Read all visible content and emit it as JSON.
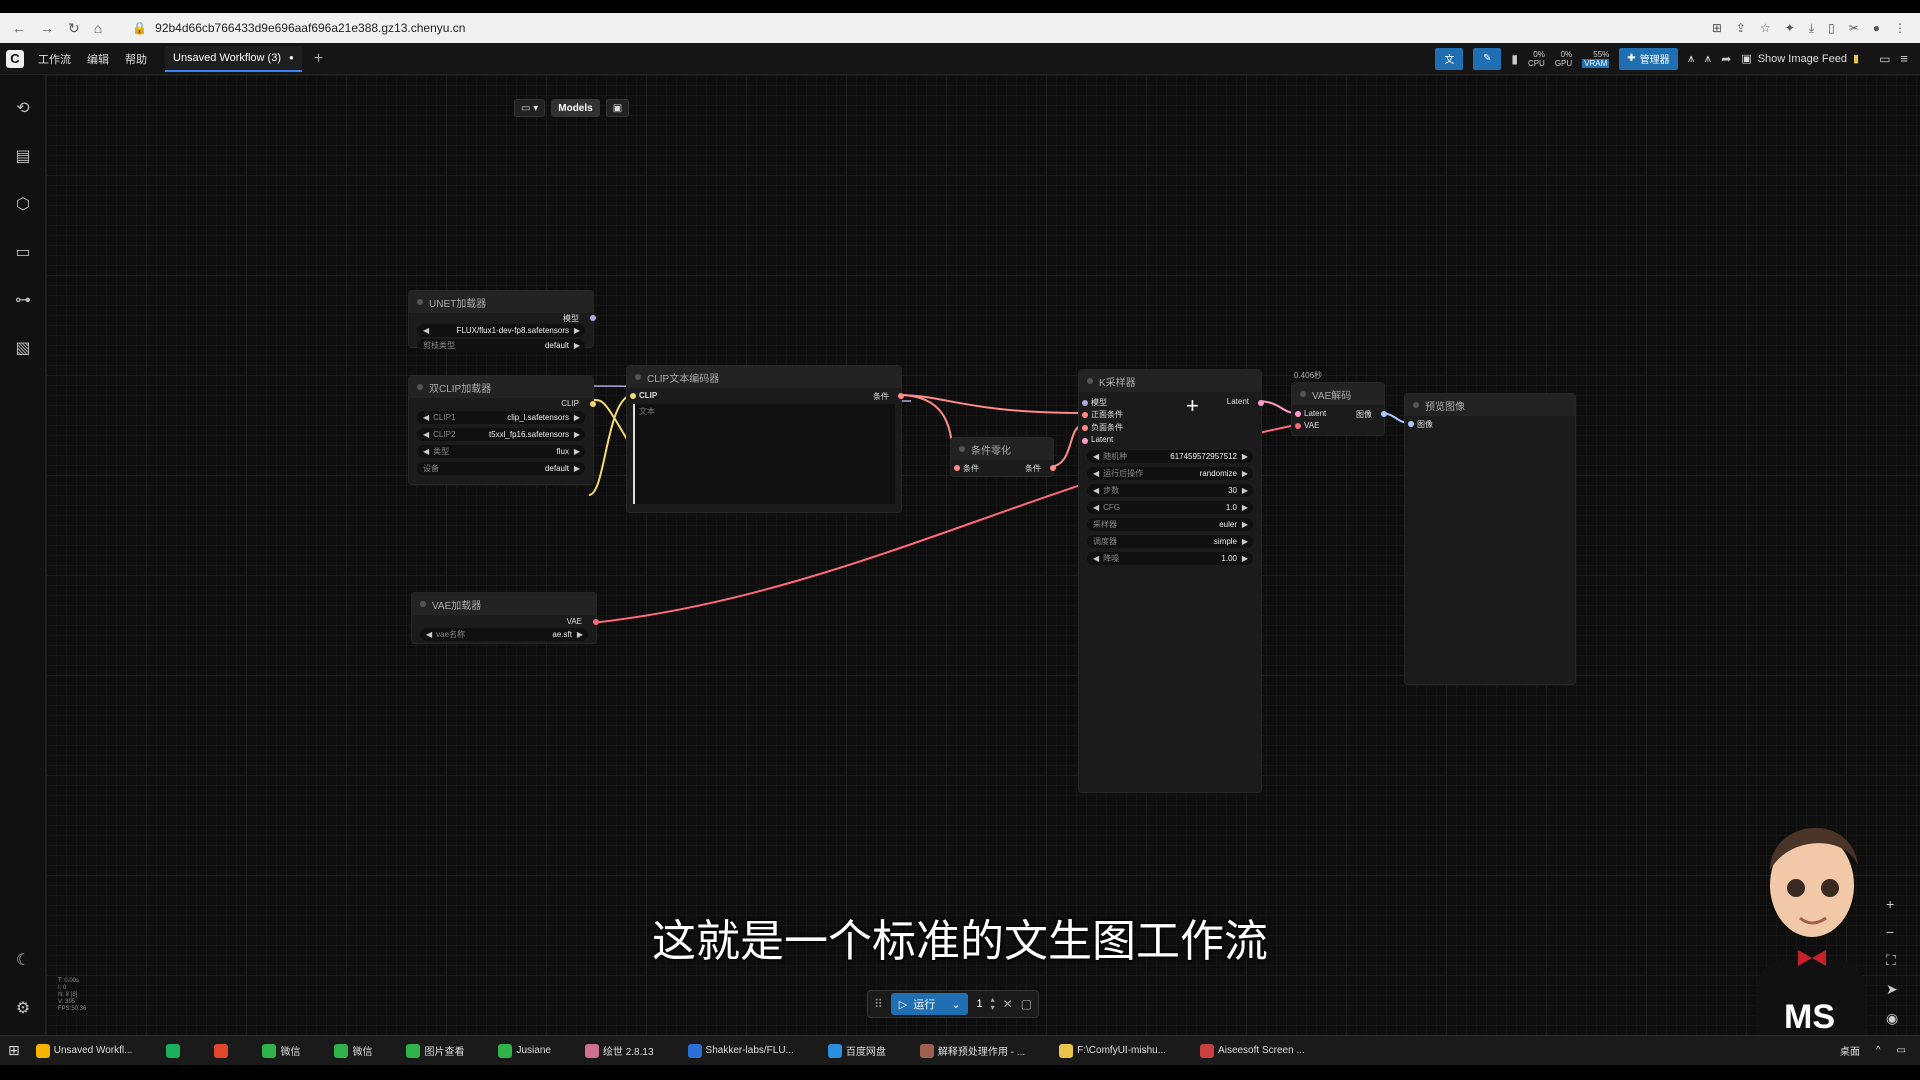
{
  "browser": {
    "url": "92b4d66cb766433d9e696aaf696a21e388.gz13.chenyu.cn"
  },
  "app": {
    "menu": [
      "工作流",
      "编辑",
      "帮助"
    ],
    "tab_label": "Unsaved Workflow (3)",
    "tab_modified_mark": "●",
    "logo_text": "C",
    "cpu_label": "CPU",
    "cpu_value": "0%",
    "gpu_label": "GPU",
    "gpu_value": "0%",
    "vram_label": "VRAM",
    "vram_value": "55%",
    "manager_label": "管理器",
    "show_image_feed_label": "Show Image Feed"
  },
  "canvas_toolbar": {
    "models_label": "Models"
  },
  "nodes": {
    "unet": {
      "title": "UNET加载器",
      "output_label": "模型",
      "w1_label": "",
      "w1_value": "FLUX/flux1-dev-fp8.safetensors",
      "w2_label": "剪枝类型",
      "w2_value": "default"
    },
    "dual_clip": {
      "title": "双CLIP加载器",
      "output_label": "CLIP",
      "w1_label": "CLIP1",
      "w1_value": "clip_l.safetensors",
      "w2_label": "CLIP2",
      "w2_value": "t5xxl_fp16.safetensors",
      "w3_label": "类型",
      "w3_value": "flux",
      "w4_label": "设备",
      "w4_value": "default"
    },
    "vae_loader": {
      "title": "VAE加载器",
      "output_label": "VAE",
      "w1_label": "vae名称",
      "w1_value": "ae.sft"
    },
    "clip_text": {
      "title": "CLIP文本编码器",
      "input_label": "CLIP",
      "output_label": "条件",
      "text_placeholder": "文本"
    },
    "cond_zero": {
      "title": "条件零化",
      "input_label": "条件",
      "output_label": "条件"
    },
    "ksampler": {
      "title": "K采样器",
      "inputs": [
        "模型",
        "正面条件",
        "负面条件",
        "Latent"
      ],
      "output_label": "Latent",
      "widgets": [
        {
          "label": "随机种",
          "value": "617459572957512"
        },
        {
          "label": "运行后操作",
          "value": "randomize"
        },
        {
          "label": "步数",
          "value": "30"
        },
        {
          "label": "CFG",
          "value": "1.0"
        },
        {
          "label": "采样器",
          "value": "euler"
        },
        {
          "label": "调度器",
          "value": "simple"
        },
        {
          "label": "降噪",
          "value": "1.00"
        }
      ]
    },
    "vae_decode": {
      "badge": "0.406秒",
      "title": "VAE解码",
      "inputs": [
        "Latent",
        "VAE"
      ],
      "output_label": "图像"
    },
    "preview": {
      "title": "预览图像",
      "input_label": "图像"
    }
  },
  "run_bar": {
    "run_label": "运行",
    "count": "1"
  },
  "subtitle": "这就是一个标准的文生图工作流",
  "stats": [
    "T: 0.00s",
    "I: 0",
    "N: 8 [8]",
    "V: 395",
    "FPS:50.36"
  ],
  "avatar_shirt_text": "MS",
  "taskbar": {
    "items": [
      {
        "label": "Unsaved Workfl...",
        "icon": "chrome-icon",
        "color": "#f4b400"
      },
      {
        "label": "",
        "icon": "r-app-icon",
        "color": "#1bb05b"
      },
      {
        "label": "",
        "icon": "bug-app-icon",
        "color": "#e2462d"
      },
      {
        "label": "微信",
        "icon": "wechat-icon",
        "color": "#2fb34a"
      },
      {
        "label": "微信",
        "icon": "wechat-icon",
        "color": "#2fb34a"
      },
      {
        "label": "图片查看",
        "icon": "wechat-icon",
        "color": "#2fb34a"
      },
      {
        "label": "Jusiane",
        "icon": "wechat-icon",
        "color": "#2fb34a"
      },
      {
        "label": "绘世 2.8.13",
        "icon": "painter-icon",
        "color": "#d07090"
      },
      {
        "label": "Shakker-labs/FLU...",
        "icon": "edge-icon",
        "color": "#2b6fd6"
      },
      {
        "label": "百度网盘",
        "icon": "baidu-icon",
        "color": "#2b8fe0"
      },
      {
        "label": "解释预处理作用 - ...",
        "icon": "person-icon",
        "color": "#a06050"
      },
      {
        "label": "F:\\ComfyUI-mishu...",
        "icon": "folder-icon",
        "color": "#e9c44a"
      },
      {
        "label": "Aiseesoft Screen ...",
        "icon": "recorder-icon",
        "color": "#c84040"
      }
    ],
    "tray_label": "桌面"
  },
  "colors": {
    "accent": "#1f6fb2",
    "clip_wire": "#f2d874",
    "cond_wire": "#ff8a8a",
    "vae_wire": "#ff6a7a",
    "model_wire": "#b0a8d8",
    "latent_wire": "#ff9ccc"
  }
}
